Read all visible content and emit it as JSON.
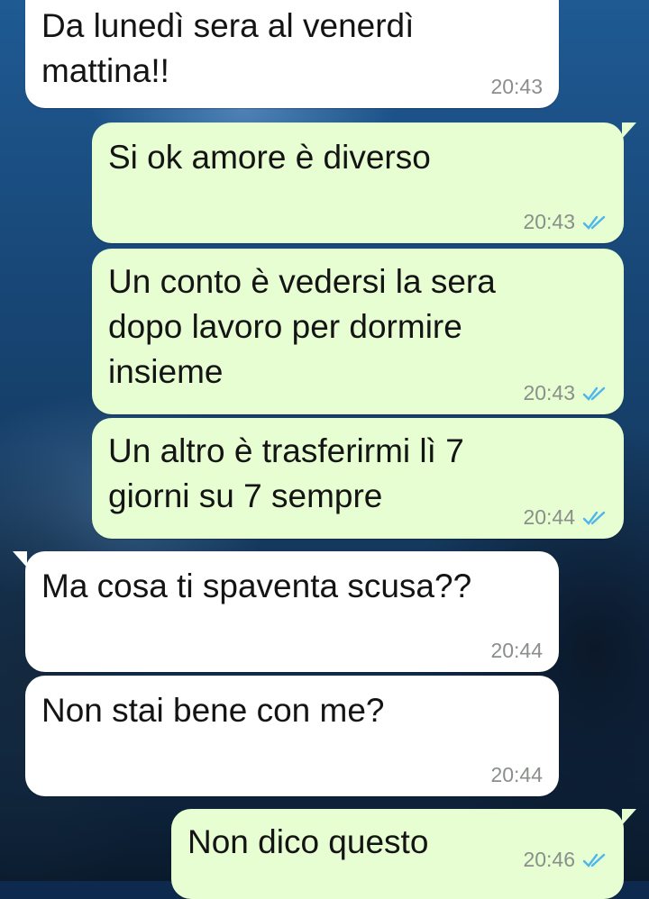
{
  "colors": {
    "incoming_bubble": "#ffffff",
    "outgoing_bubble": "#e6fed2",
    "timestamp": "#8a8f8a",
    "read_ticks": "#4fb6ec"
  },
  "messages": [
    {
      "direction": "incoming",
      "text": "Da lunedì sera al venerdì\nmattina!!",
      "time": "20:43"
    },
    {
      "direction": "outgoing",
      "text": "Si ok amore è diverso",
      "time": "20:43",
      "status_icon": "double-check-read-icon"
    },
    {
      "direction": "outgoing",
      "text": "Un conto è vedersi la sera\ndopo lavoro per dormire\ninsieme",
      "time": "20:43",
      "status_icon": "double-check-read-icon"
    },
    {
      "direction": "outgoing",
      "text": "Un altro è trasferirmi lì 7\ngiorni su 7 sempre",
      "time": "20:44",
      "status_icon": "double-check-read-icon"
    },
    {
      "direction": "incoming",
      "text": "Ma cosa ti spaventa scusa??",
      "time": "20:44"
    },
    {
      "direction": "incoming",
      "text": "Non stai bene con me?",
      "time": "20:44"
    },
    {
      "direction": "outgoing",
      "text": "Non dico questo",
      "time": "20:46",
      "status_icon": "double-check-read-icon"
    }
  ]
}
